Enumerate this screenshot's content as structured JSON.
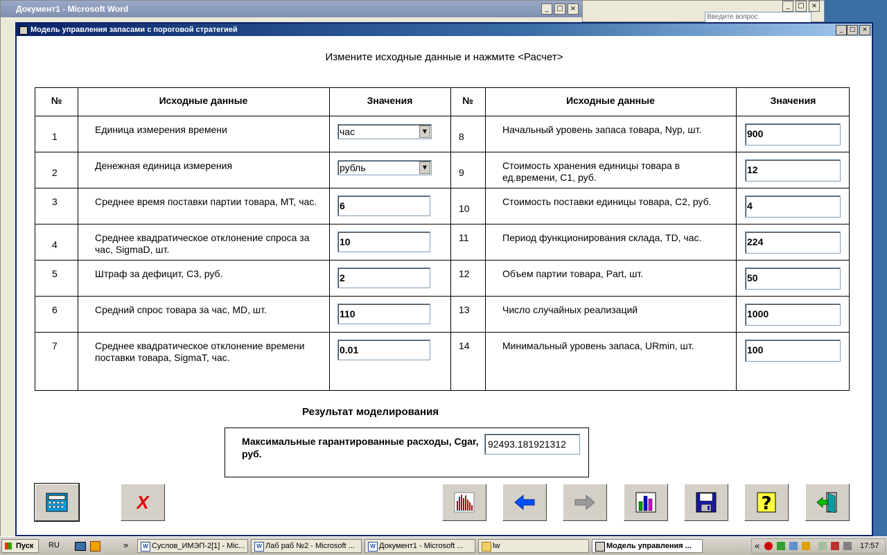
{
  "background_windows": {
    "word_title": "Документ1 - Microsoft Word",
    "help_box_placeholder": "Введите вопрос"
  },
  "window": {
    "title": "Модель управления запасами с пороговой стратегией",
    "instruction": "Измените исходные данные и нажмите <Расчет>"
  },
  "table": {
    "headers": {
      "num": "№",
      "source": "Исходные данные",
      "values": "Значения"
    },
    "left_rows": [
      {
        "num": "1",
        "label": "Единица измерения времени",
        "value": "час",
        "kind": "select"
      },
      {
        "num": "2",
        "label": "Денежная единица измерения",
        "value": "рубль",
        "kind": "select"
      },
      {
        "num": "3",
        "label": "Среднее время поставки партии товара, MT, час.",
        "value": "6",
        "kind": "input"
      },
      {
        "num": "4",
        "label": "Среднее квадратическое отклонение спроса за час, SigmaD, шт.",
        "value": "10",
        "kind": "input"
      },
      {
        "num": "5",
        "label": "Штраф за дефицит, C3, руб.",
        "value": "2",
        "kind": "input"
      },
      {
        "num": "6",
        "label": "Средний спрос товара за час, MD, шт.",
        "value": "110",
        "kind": "input"
      },
      {
        "num": "7",
        "label": "Среднее квадратическое отклонение времени поставки товара, SigmaT, час.",
        "value": "0.01",
        "kind": "input"
      }
    ],
    "right_rows": [
      {
        "num": "8",
        "label": "Начальный уровень запаса товара, Nyp, шт.",
        "value": "900"
      },
      {
        "num": "9",
        "label": "Стоимость хранения единицы товара в ед.времени, C1, руб.",
        "value": "12"
      },
      {
        "num": "10",
        "label": "Стоимость поставки единицы товара, C2, руб.",
        "value": "4"
      },
      {
        "num": "11",
        "label": "Период функционирования склада, TD, час.",
        "value": "224"
      },
      {
        "num": "12",
        "label": "Объем партии товара, Part, шт.",
        "value": "50"
      },
      {
        "num": "13",
        "label": "Число случайных реализаций",
        "value": "1000"
      },
      {
        "num": "14",
        "label": "Минимальный уровень запаса, URmin, шт.",
        "value": "100"
      }
    ]
  },
  "result": {
    "title": "Результат моделирования",
    "label": "Максимальные гарантированные расходы, Cgar, руб.",
    "value": "92493.181921312"
  },
  "toolbar": {
    "icons": [
      "calculator-icon",
      "cancel-x-icon",
      "histogram-icon",
      "back-arrow-icon",
      "forward-arrow-icon",
      "bar-chart-icon",
      "save-icon",
      "help-icon",
      "exit-icon"
    ],
    "cancel_glyph": "X",
    "help_glyph": "?"
  },
  "taskbar": {
    "start": "Пуск",
    "lang": "RU",
    "chevron": "»",
    "tray_chevron": "«",
    "tasks": [
      "Суслов_ИМЭП-2[1] - Mic...",
      "Лаб раб №2 - Microsoft ...",
      "Документ1 - Microsoft ...",
      "lw",
      "Модель управления ..."
    ],
    "clock": "17:57"
  },
  "colors": {
    "title_bar": "#0a246a",
    "desktop": "#3a6ea5",
    "cancel_red": "#e00000",
    "arrow_blue": "#0050ff"
  }
}
